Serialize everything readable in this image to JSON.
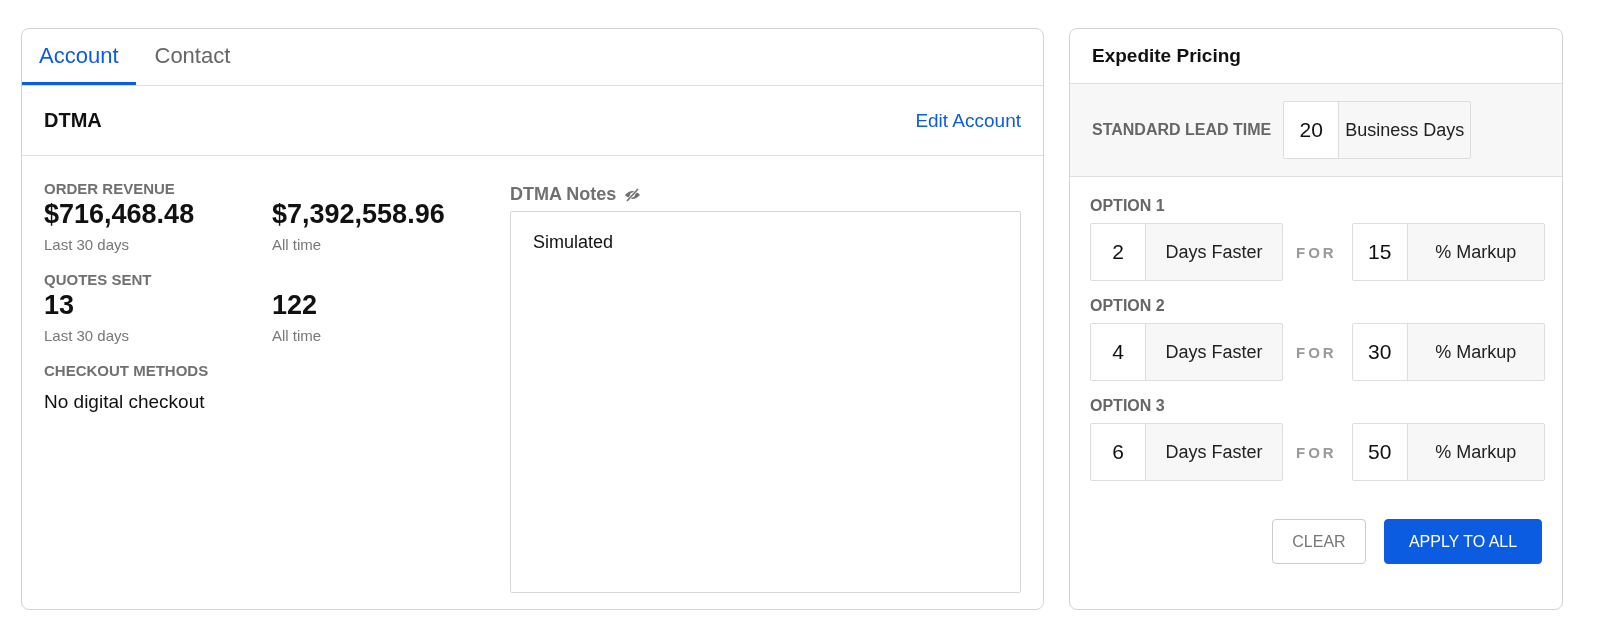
{
  "tabs": [
    {
      "label": "Account",
      "selected": true
    },
    {
      "label": "Contact",
      "selected": false
    }
  ],
  "account": {
    "name": "DTMA",
    "edit_link": "Edit Account",
    "stat_groups": [
      {
        "label": "ORDER REVENUE",
        "stats": [
          {
            "value": "$716,468.48",
            "period": "Last 30 days"
          },
          {
            "value": "$7,392,558.96",
            "period": "All time"
          }
        ]
      },
      {
        "label": "QUOTES SENT",
        "stats": [
          {
            "value": "13",
            "period": "Last 30 days"
          },
          {
            "value": "122",
            "period": "All time"
          }
        ]
      }
    ],
    "checkout": {
      "label": "CHECKOUT METHODS",
      "value": "No digital checkout"
    },
    "notes": {
      "label": "DTMA Notes",
      "value": "Simulated"
    }
  },
  "expedite": {
    "title": "Expedite Pricing",
    "lead_time": {
      "label": "STANDARD LEAD TIME",
      "value": "20",
      "unit": "Business Days"
    },
    "options": [
      {
        "label": "OPTION 1",
        "days": "2",
        "days_unit": "Days Faster",
        "connector": "FOR",
        "markup": "15",
        "markup_unit": "% Markup"
      },
      {
        "label": "OPTION 2",
        "days": "4",
        "days_unit": "Days Faster",
        "connector": "FOR",
        "markup": "30",
        "markup_unit": "% Markup"
      },
      {
        "label": "OPTION 3",
        "days": "6",
        "days_unit": "Days Faster",
        "connector": "FOR",
        "markup": "50",
        "markup_unit": "% Markup"
      }
    ],
    "buttons": [
      {
        "label": "CLEAR",
        "kind": "secondary"
      },
      {
        "label": "APPLY TO ALL",
        "kind": "primary"
      }
    ]
  }
}
